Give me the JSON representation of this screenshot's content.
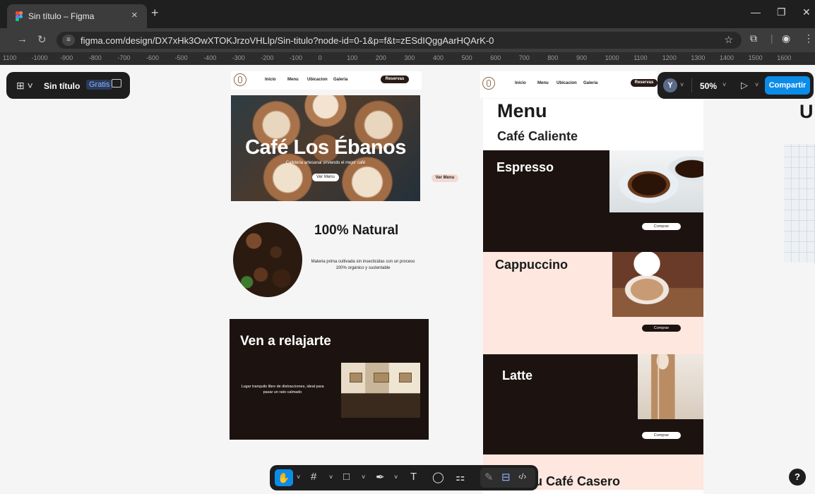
{
  "browser": {
    "tab_title": "Sin título – Figma",
    "url": "figma.com/design/DX7xHk3OwXTOKJrzoVHLlp/Sin-titulo?node-id=0-1&p=f&t=zESdIQggAarHQArK-0"
  },
  "ruler": [
    "1100",
    "-1000",
    "-900",
    "-800",
    "-700",
    "-600",
    "-500",
    "-400",
    "-300",
    "-200",
    "-100",
    "0",
    "100",
    "200",
    "300",
    "400",
    "500",
    "600",
    "700",
    "800",
    "900",
    "1000",
    "1100",
    "1200",
    "1300",
    "1400",
    "1500",
    "1600"
  ],
  "figma": {
    "file_name": "Sin título",
    "plan_badge": "Gratis",
    "avatar_initial": "Y",
    "zoom": "50%",
    "share_label": "Compartir",
    "help": "?"
  },
  "home": {
    "nav": [
      "Inicio",
      "Menu",
      "Ubicacion",
      "Galeria"
    ],
    "reserve": "Reservas",
    "hero_title": "Café Los Ébanos",
    "hero_sub": "Cafeteria artesanal sirviendo el mejor café",
    "hero_btn": "Ver Menu",
    "floating_btn": "Ver Menu",
    "natural_title": "100% Natural",
    "natural_desc": "Materia prima cultivada sin insecticidas con un proceso 100% orgánico y sustentable",
    "relax_title": "Ven a relajarte",
    "relax_desc": "Lugar tranquilo libre de distracciones, ideal para pasar un rato calmado"
  },
  "menu": {
    "nav": [
      "Inicio",
      "Menu",
      "Ubicacion",
      "Galeria"
    ],
    "reserve": "Reservas",
    "title": "Menu",
    "subtitle": "Café Caliente",
    "items": [
      {
        "name": "Espresso",
        "button": "Comprar"
      },
      {
        "name": "Cappuccino",
        "button": "Comprar"
      },
      {
        "name": "Latte",
        "button": "Comprar"
      }
    ],
    "next_section": "u Café Casero"
  },
  "third_frame_letter": "U",
  "colors": {
    "dark_brown": "#1c1310",
    "peach": "#fde7df",
    "figma_blue": "#0c8ce9"
  }
}
